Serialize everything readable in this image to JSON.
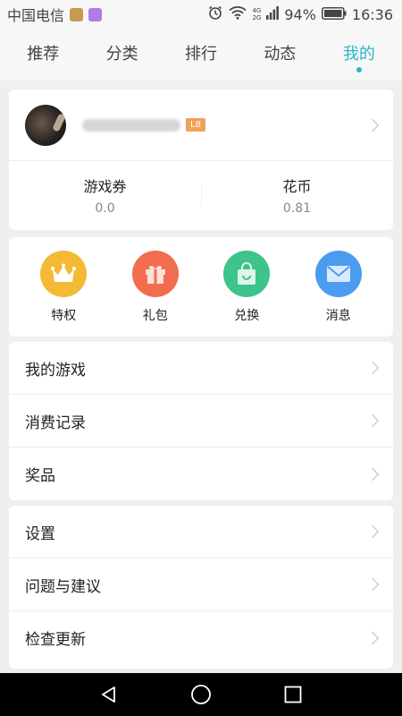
{
  "status_bar": {
    "carrier": "中国电信",
    "network_top": "4G",
    "network_bottom": "2G",
    "battery": "94%",
    "time": "16:36"
  },
  "tabs": [
    {
      "label": "推荐",
      "active": false
    },
    {
      "label": "分类",
      "active": false
    },
    {
      "label": "排行",
      "active": false
    },
    {
      "label": "动态",
      "active": false
    },
    {
      "label": "我的",
      "active": true
    }
  ],
  "profile": {
    "level": "L8",
    "stats": [
      {
        "label": "游戏券",
        "value": "0.0"
      },
      {
        "label": "花币",
        "value": "0.81"
      }
    ]
  },
  "quick_actions": [
    {
      "label": "特权",
      "icon": "crown-icon",
      "color": "#f4b935"
    },
    {
      "label": "礼包",
      "icon": "gift-icon",
      "color": "#f26d4f"
    },
    {
      "label": "兑换",
      "icon": "shopping-bag-icon",
      "color": "#3cc48a"
    },
    {
      "label": "消息",
      "icon": "envelope-icon",
      "color": "#4b9cf0"
    }
  ],
  "menu_group_1": [
    {
      "label": "我的游戏"
    },
    {
      "label": "消费记录"
    },
    {
      "label": "奖品"
    }
  ],
  "menu_group_2": [
    {
      "label": "设置"
    },
    {
      "label": "问题与建议"
    },
    {
      "label": "检查更新"
    }
  ],
  "colors": {
    "accent": "#28b6c5",
    "level_badge": "#f0a15a"
  }
}
